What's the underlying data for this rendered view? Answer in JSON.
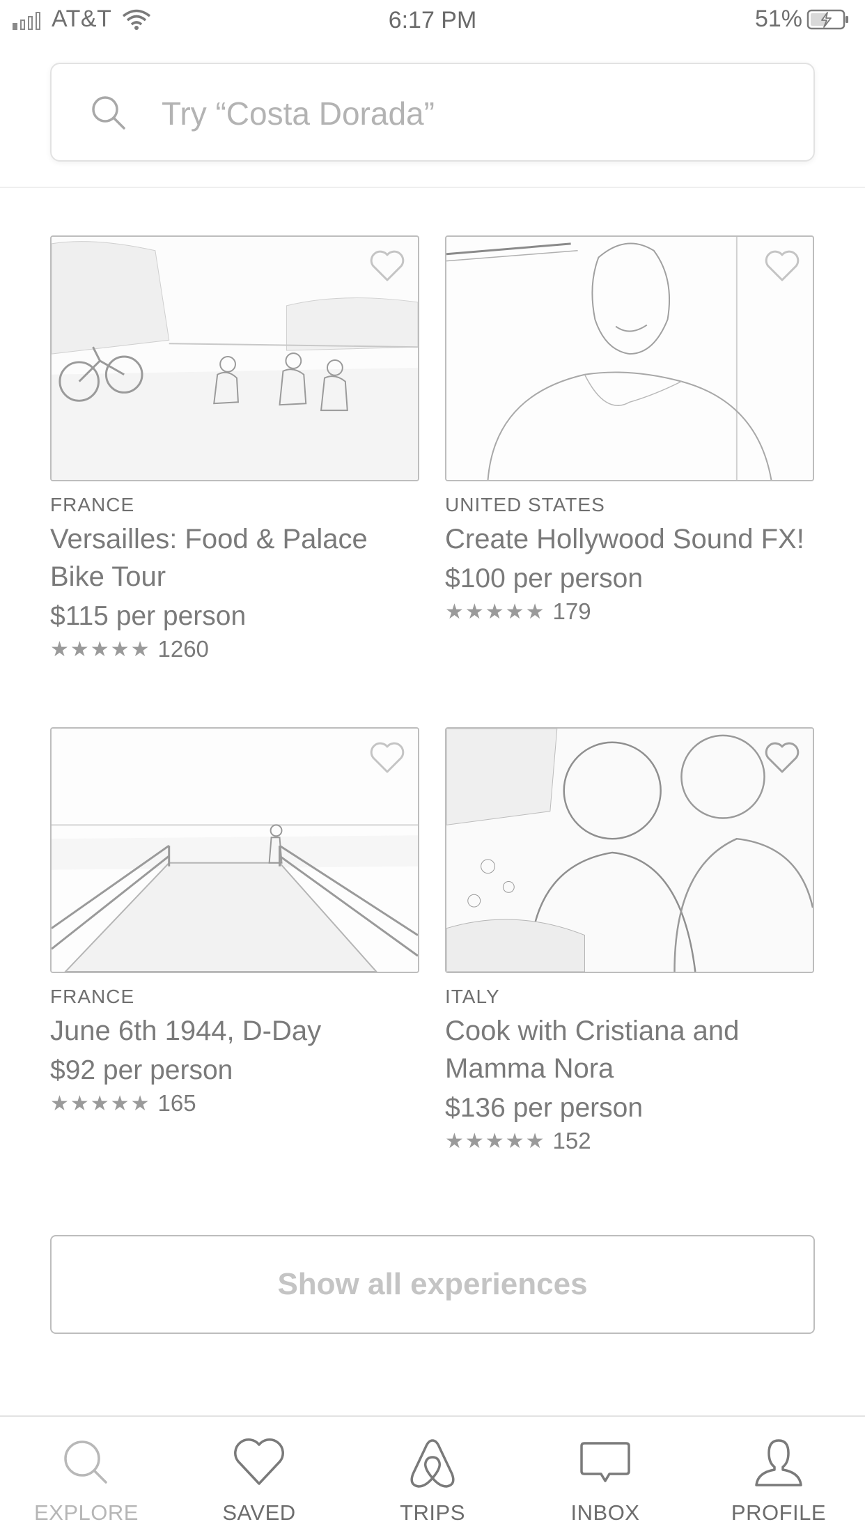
{
  "status_bar": {
    "carrier": "AT&T",
    "time": "6:17 PM",
    "battery": "51%"
  },
  "search": {
    "placeholder": "Try “Costa Dorada”"
  },
  "experiences": [
    {
      "country": "FRANCE",
      "title": "Versailles: Food & Palace Bike Tour",
      "price": "$115 per person",
      "stars": "★★★★★",
      "reviews": "1260",
      "icon": "heart-icon"
    },
    {
      "country": "UNITED STATES",
      "title": "Create Hollywood Sound FX!",
      "price": "$100 per person",
      "stars": "★★★★★",
      "reviews": "179",
      "icon": "heart-icon"
    },
    {
      "country": "FRANCE",
      "title": "June 6th 1944, D-Day",
      "price": "$92 per person",
      "stars": "★★★★★",
      "reviews": "165",
      "icon": "heart-icon"
    },
    {
      "country": "ITALY",
      "title": "Cook with Cristiana and Mamma Nora",
      "price": "$136 per person",
      "stars": "★★★★★",
      "reviews": "152",
      "icon": "heart-icon"
    }
  ],
  "show_all_label": "Show all experiences",
  "tabs": [
    {
      "label": "EXPLORE",
      "icon": "search-icon",
      "active": true
    },
    {
      "label": "SAVED",
      "icon": "heart-icon",
      "active": false
    },
    {
      "label": "TRIPS",
      "icon": "airbnb-logo-icon",
      "active": false
    },
    {
      "label": "INBOX",
      "icon": "chat-bubble-icon",
      "active": false
    },
    {
      "label": "PROFILE",
      "icon": "person-icon",
      "active": false
    }
  ]
}
